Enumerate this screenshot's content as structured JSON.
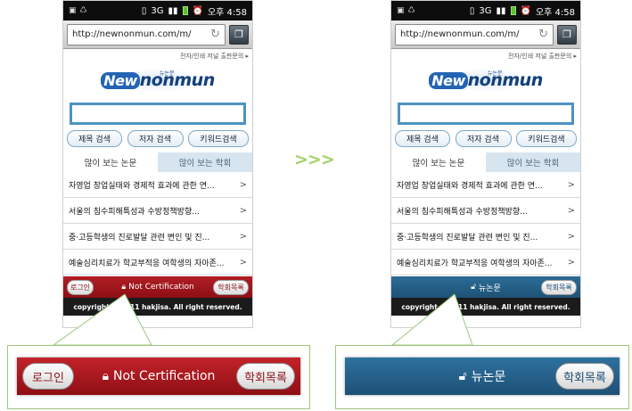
{
  "status_bar": {
    "time": "오후 4:58"
  },
  "browser": {
    "url": "http://newnonmun.com/m/"
  },
  "site": {
    "top_note": "전자/인쇄 저널 출판문의 ▸",
    "logo_text": "nonmun",
    "logo_script": "New",
    "logo_tag": "뉴논문",
    "search_buttons": [
      "제목 검색",
      "저자 검색",
      "키워드검색"
    ],
    "tabs": [
      "많이 보는 논문",
      "많이 보는 학회"
    ],
    "articles": [
      "자영업 창업실태와 경제적 효과에 관한 연...",
      "서울의 침수피해특성과 수방정책방향...",
      "중·고등학생의 진로발달 관련 변인 및 진...",
      "예술심리치료가 학교부적응 여학생의 자아존..."
    ],
    "arrow": ">",
    "copyright": "copyright © 2011 hakjisa. All right reserved."
  },
  "left_footer": {
    "login": "로그인",
    "status": "Not Certification",
    "societies": "학회목록"
  },
  "right_footer": {
    "status": "뉴논문",
    "societies": "학회목록"
  },
  "transition_arrows": ">>>"
}
